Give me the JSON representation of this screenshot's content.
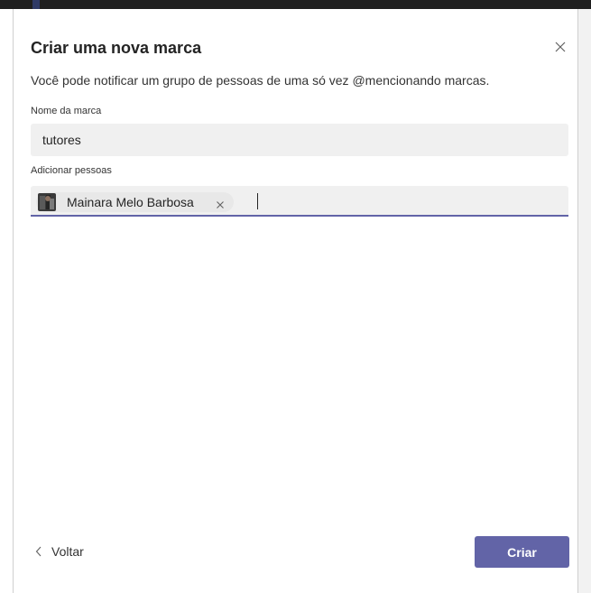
{
  "dialog": {
    "title": "Criar uma nova marca",
    "description": "Você pode notificar um grupo de pessoas de uma só vez @mencionando marcas.",
    "close_icon": "close-icon"
  },
  "tag_name": {
    "label": "Nome da marca",
    "value": "tutores"
  },
  "add_people": {
    "label": "Adicionar pessoas",
    "chips": [
      {
        "name": "Mainara Melo Barbosa",
        "avatar_icon": "avatar",
        "remove_icon": "close-icon"
      }
    ],
    "value": ""
  },
  "footer": {
    "back_label": "Voltar",
    "back_icon": "chevron-left-icon",
    "create_label": "Criar"
  },
  "colors": {
    "accent": "#6264a7",
    "input_background": "#f0f0f0",
    "text": "#242424"
  }
}
